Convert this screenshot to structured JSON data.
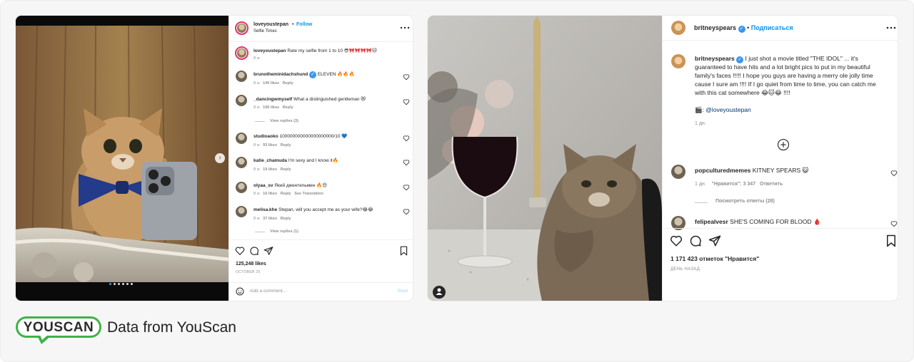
{
  "post1": {
    "username": "loveyoustepan",
    "follow_label": "Follow",
    "subtitle": "Selfie Times",
    "caption_user": "loveyoustepan",
    "caption_text": "Rate my selfie from 1 to 10 😎🎀🎀🎀🎀🐱",
    "caption_time": "8 w",
    "comments": [
      {
        "user": "brunotheminidachshund",
        "verified": true,
        "text": "ELEVEN 🔥🔥🔥",
        "time": "8 w",
        "likes": "140 likes",
        "reply": "Reply",
        "extra": ""
      },
      {
        "user": "_dancingwmyself",
        "verified": false,
        "text": "What a distinguished gentleman 😻",
        "time": "8 w",
        "likes": "156 likes",
        "reply": "Reply",
        "extra": ""
      },
      {
        "user": "studioaoko",
        "verified": false,
        "text": "100000000000000000000/10 💙",
        "time": "8 w",
        "likes": "93 likes",
        "reply": "Reply",
        "extra": ""
      },
      {
        "user": "katie_chamuda",
        "verified": false,
        "text": "I'm sexy and I know it🔥",
        "time": "8 w",
        "likes": "19 likes",
        "reply": "Reply",
        "extra": ""
      },
      {
        "user": "olyaa_sv",
        "verified": false,
        "text": "Який джентельмен 🔥😍",
        "time": "8 w",
        "likes": "16 likes",
        "reply": "Reply",
        "extra": "See Translation"
      },
      {
        "user": "melisa.khe",
        "verified": false,
        "text": "Stepan, will you accept me as your wife?😂😂",
        "time": "8 w",
        "likes": "37 likes",
        "reply": "Reply",
        "extra": ""
      }
    ],
    "view_replies_1": "View replies (3)",
    "view_replies_2": "View replies (1)",
    "likes": "125,248 likes",
    "date": "OCTOBER 25",
    "add_comment_placeholder": "Add a comment...",
    "post_label": "Post",
    "carousel_index": 0,
    "carousel_count": 6
  },
  "post2": {
    "username": "britneyspears",
    "subscribe_label": "Подписаться",
    "caption_user": "britneyspears",
    "caption_text": "I just shot a movie titled \"THE IDOL\" ... it's guaranteed to have hits and a lot bright pics to put in my beautiful family's faces !!!!! I hope you guys are having a merry ole jolly time cause I sure am !!!! If I go quiet from time to time, you can catch me with this cat somewhere 😂🐱😂 !!!!",
    "caption_line1": "I just shot a movie titled \"THE IDOL\" ... it's",
    "caption_line2": "guaranteed to have hits and a lot bright pics to put in my beautiful",
    "caption_line3": "family's faces !!!!! I hope you guys are having a merry ole jolly time",
    "caption_line4": "cause I sure am !!!! If I go quiet from time to time, you can catch me",
    "caption_line5": "with this cat somewhere 😂🐱😂 !!!!",
    "mention": "🎬: @loveyoustepan",
    "caption_time": "1 дн.",
    "comments": [
      {
        "user": "popculturedmemes",
        "text": "KITNEY SPEARS 😺",
        "time": "1 дн.",
        "likes": "\"Нравится\": 3 347",
        "reply": "Ответить"
      },
      {
        "user": "felipealvesr",
        "text": "SHE'S COMING FOR BLOOD 🩸"
      }
    ],
    "view_replies": "Посмотреть ответы (28)",
    "likes": "1 171 423 отметок \"Нравится\"",
    "date": "ДЕНЬ НАЗАД"
  },
  "brand": {
    "logo_text": "YOUSCAN",
    "label": "Data from YouScan"
  },
  "colors": {
    "accent_blue": "#0095f6",
    "brand_green": "#3fb248",
    "verified_blue": "#3897f0"
  }
}
